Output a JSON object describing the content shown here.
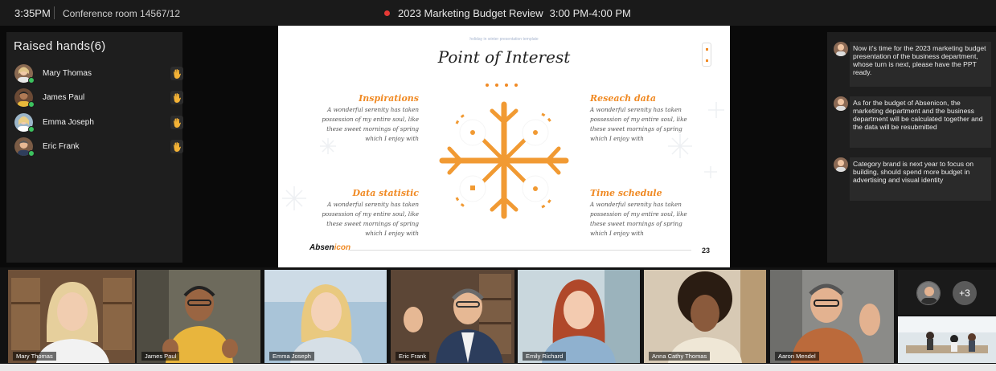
{
  "header": {
    "time": "3:35PM",
    "room": "Conference room 14567/12",
    "meeting_title": "2023 Marketing Budget Review",
    "meeting_time": "3:00 PM-4:00 PM"
  },
  "raised_hands": {
    "title": "Raised hands(6)",
    "people": [
      {
        "name": "Mary Thomas"
      },
      {
        "name": "James Paul"
      },
      {
        "name": "Emma Joseph"
      },
      {
        "name": "Eric Frank"
      }
    ]
  },
  "slide": {
    "top_caption": "holiday in winter presentation template",
    "title": "Point of Interest",
    "sections": [
      {
        "heading": "Inspirations",
        "lines": [
          "A wonderful serenity has taken",
          "possession of my entire soul, like",
          "these sweet mornings of spring",
          "which I enjoy with"
        ]
      },
      {
        "heading": "Reseach data",
        "lines": [
          "A wonderful serenity has taken",
          "possession of my entire soul, like",
          "these sweet mornings of spring",
          "which I enjoy with"
        ]
      },
      {
        "heading": "Data statistic",
        "lines": [
          "A wonderful serenity has taken",
          "possession of my entire soul, like",
          "these sweet mornings of spring",
          "which I enjoy with"
        ]
      },
      {
        "heading": "Time schedule",
        "lines": [
          "A wonderful serenity has taken",
          "possession of my entire soul, like",
          "these sweet mornings of spring",
          "which I enjoy with"
        ]
      }
    ],
    "logo_a": "Absen",
    "logo_b": "icon",
    "page_number": "23",
    "accent": "#f08a24"
  },
  "chat": {
    "messages": [
      {
        "text": "Now it's time for the 2023 marketing budget presentation of the business department, whose turn is next, please have the PPT ready."
      },
      {
        "text": "As for the budget of Absenicon, the marketing department and the business department will be calculated together and the data will be resubmitted"
      },
      {
        "text": "Category brand is next year to focus on building, should spend more budget in advertising and visual identity"
      }
    ]
  },
  "participants": [
    {
      "name": "Mary Thomas"
    },
    {
      "name": "James Paul"
    },
    {
      "name": "Emma Joseph"
    },
    {
      "name": "Eric Frank"
    },
    {
      "name": "Emily Richard"
    },
    {
      "name": "Anna Cathy Thomas"
    },
    {
      "name": "Aaron Mendel"
    }
  ],
  "more_count": "+3",
  "icons": {
    "recording": "recording-dot-icon",
    "raised_hand": "raised-hand-icon",
    "online": "online-status-icon"
  }
}
